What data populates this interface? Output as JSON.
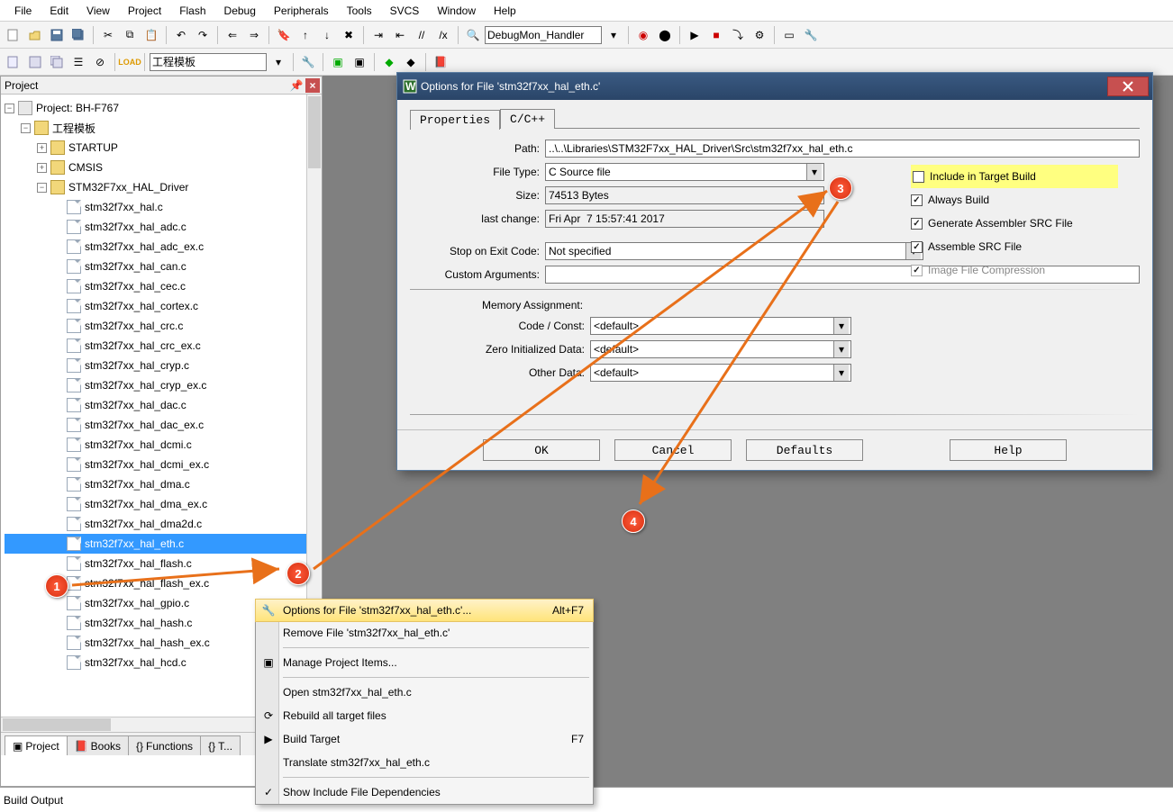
{
  "menu": [
    "File",
    "Edit",
    "View",
    "Project",
    "Flash",
    "Debug",
    "Peripherals",
    "Tools",
    "SVCS",
    "Window",
    "Help"
  ],
  "toolbar1": {
    "combo": "DebugMon_Handler"
  },
  "toolbar2": {
    "target": "工程模板"
  },
  "projectPanel": {
    "title": "Project",
    "root": "Project: BH-F767",
    "workspace": "工程模板",
    "folders": [
      {
        "name": "STARTUP",
        "expanded": false
      },
      {
        "name": "CMSIS",
        "expanded": false
      },
      {
        "name": "STM32F7xx_HAL_Driver",
        "expanded": true
      }
    ],
    "files": [
      "stm32f7xx_hal.c",
      "stm32f7xx_hal_adc.c",
      "stm32f7xx_hal_adc_ex.c",
      "stm32f7xx_hal_can.c",
      "stm32f7xx_hal_cec.c",
      "stm32f7xx_hal_cortex.c",
      "stm32f7xx_hal_crc.c",
      "stm32f7xx_hal_crc_ex.c",
      "stm32f7xx_hal_cryp.c",
      "stm32f7xx_hal_cryp_ex.c",
      "stm32f7xx_hal_dac.c",
      "stm32f7xx_hal_dac_ex.c",
      "stm32f7xx_hal_dcmi.c",
      "stm32f7xx_hal_dcmi_ex.c",
      "stm32f7xx_hal_dma.c",
      "stm32f7xx_hal_dma_ex.c",
      "stm32f7xx_hal_dma2d.c",
      "stm32f7xx_hal_eth.c",
      "stm32f7xx_hal_flash.c",
      "stm32f7xx_hal_flash_ex.c",
      "stm32f7xx_hal_gpio.c",
      "stm32f7xx_hal_hash.c",
      "stm32f7xx_hal_hash_ex.c",
      "stm32f7xx_hal_hcd.c"
    ],
    "selectedFile": "stm32f7xx_hal_eth.c",
    "tabs": [
      "Project",
      "Books",
      "Functions",
      "T..."
    ]
  },
  "contextMenu": {
    "items": [
      {
        "label": "Options for File 'stm32f7xx_hal_eth.c'...",
        "shortcut": "Alt+F7",
        "icon": "wrench",
        "hl": true
      },
      {
        "label": "Remove File 'stm32f7xx_hal_eth.c'"
      },
      {
        "sep": true
      },
      {
        "label": "Manage Project Items...",
        "icon": "stack"
      },
      {
        "sep": true
      },
      {
        "label": "Open stm32f7xx_hal_eth.c"
      },
      {
        "label": "Rebuild all target files",
        "icon": "rebuild"
      },
      {
        "label": "Build Target",
        "shortcut": "F7",
        "icon": "build"
      },
      {
        "label": "Translate stm32f7xx_hal_eth.c"
      },
      {
        "sep": true
      },
      {
        "label": "Show Include File Dependencies",
        "icon": "check"
      }
    ]
  },
  "dialog": {
    "title": "Options for File 'stm32f7xx_hal_eth.c'",
    "tabs": [
      "Properties",
      "C/C++"
    ],
    "activeTab": 0,
    "labels": {
      "path": "Path:",
      "fileType": "File Type:",
      "size": "Size:",
      "lastChange": "last change:",
      "stopExit": "Stop on Exit Code:",
      "customArgs": "Custom Arguments:",
      "memAssign": "Memory Assignment:",
      "codeConst": "Code / Const:",
      "zeroInit": "Zero Initialized Data:",
      "otherData": "Other Data:"
    },
    "values": {
      "path": "..\\..\\Libraries\\STM32F7xx_HAL_Driver\\Src\\stm32f7xx_hal_eth.c",
      "fileType": "C Source file",
      "size": "74513 Bytes",
      "lastChange": "Fri Apr  7 15:57:41 2017",
      "stopExit": "Not specified",
      "customArgs": "",
      "codeConst": "<default>",
      "zeroInit": "<default>",
      "otherData": "<default>"
    },
    "checks": [
      {
        "label": "Include in Target Build",
        "checked": false,
        "hl": true
      },
      {
        "label": "Always Build",
        "checked": true
      },
      {
        "label": "Generate Assembler SRC File",
        "checked": true
      },
      {
        "label": "Assemble SRC File",
        "checked": true
      },
      {
        "label": "Image File Compression",
        "checked": true,
        "disabled": true
      }
    ],
    "buttons": [
      "OK",
      "Cancel",
      "Defaults",
      "Help"
    ]
  },
  "buildOutput": "Build Output",
  "badges": [
    "1",
    "2",
    "3",
    "4"
  ]
}
